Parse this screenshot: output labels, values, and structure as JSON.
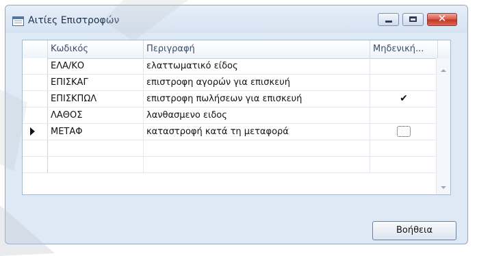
{
  "window": {
    "title": "Αιτίες Επιστροφών",
    "icon": "table-icon",
    "controls": {
      "minimize": "minimize-icon",
      "maximize": "maximize-icon",
      "close": "close-icon"
    }
  },
  "grid": {
    "columns": {
      "code": "Κωδικός",
      "description": "Περιγραφή",
      "zero": "Μηδενική..."
    },
    "rows": [
      {
        "code": "ΕΛΑ/ΚΟ",
        "description": "ελαττωματικό είδος",
        "zero": ""
      },
      {
        "code": "ΕΠΙΣΚΑΓ",
        "description": "επιστροφη αγορών για επισκευή",
        "zero": ""
      },
      {
        "code": "ΕΠΙΣΚΠΩΛ",
        "description": "επιστροφη πωλήσεων για επισκευή",
        "zero": "✔"
      },
      {
        "code": "ΛΑΘΟΣ",
        "description": "λανθασμενο ειδος",
        "zero": ""
      },
      {
        "code": "ΜΕΤΑΦ",
        "description": "καταστροφή κατά τη μεταφορά",
        "zero": "",
        "current": true
      },
      {
        "code": "",
        "description": "",
        "zero": ""
      },
      {
        "code": "",
        "description": "",
        "zero": ""
      }
    ]
  },
  "footer": {
    "help_label": "Βοήθεια"
  },
  "colors": {
    "accent": "#4d6a92",
    "close": "#c23523",
    "watermark": "#c0c6cf"
  }
}
